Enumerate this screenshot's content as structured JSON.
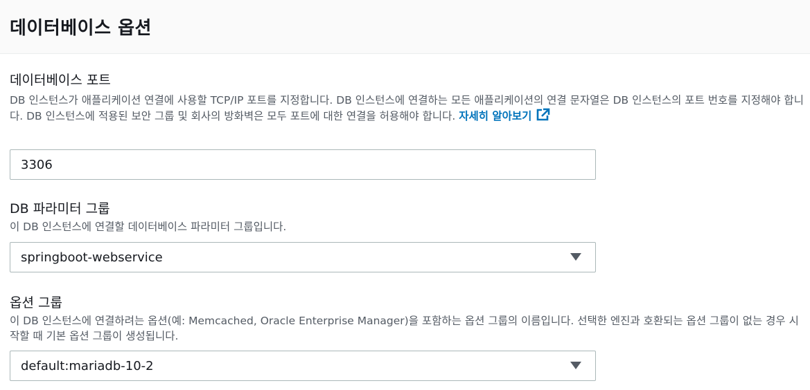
{
  "section": {
    "title": "데이터베이스 옵션"
  },
  "port": {
    "label": "데이터베이스 포트",
    "description": "DB 인스턴스가 애플리케이션 연결에 사용할 TCP/IP 포트를 지정합니다. DB 인스턴스에 연결하는 모든 애플리케이션의 연결 문자열은 DB 인스턴스의 포트 번호를 지정해야 합니다. DB 인스턴스에 적용된 보안 그룹 및 회사의 방화벽은 모두 포트에 대한 연결을 허용해야 합니다. ",
    "learn_more": "자세히 알아보기",
    "value": "3306"
  },
  "param_group": {
    "label": "DB 파라미터 그룹",
    "description": "이 DB 인스턴스에 연결할 데이터베이스 파라미터 그룹입니다.",
    "selected": "springboot-webservice"
  },
  "option_group": {
    "label": "옵션 그룹",
    "description": "이 DB 인스턴스에 연결하려는 옵션(예: Memcached, Oracle Enterprise Manager)을 포함하는 옵션 그룹의 이름입니다. 선택한 엔진과 호환되는 옵션 그룹이 없는 경우 시작할 때 기본 옵션 그룹이 생성됩니다.",
    "selected": "default:mariadb-10-2"
  },
  "icons": {
    "external_link": "external-link-icon",
    "dropdown": "caret-down-icon"
  },
  "colors": {
    "link": "#0073bb",
    "text": "#16191f",
    "muted": "#545b64",
    "border": "#aab7b8"
  }
}
